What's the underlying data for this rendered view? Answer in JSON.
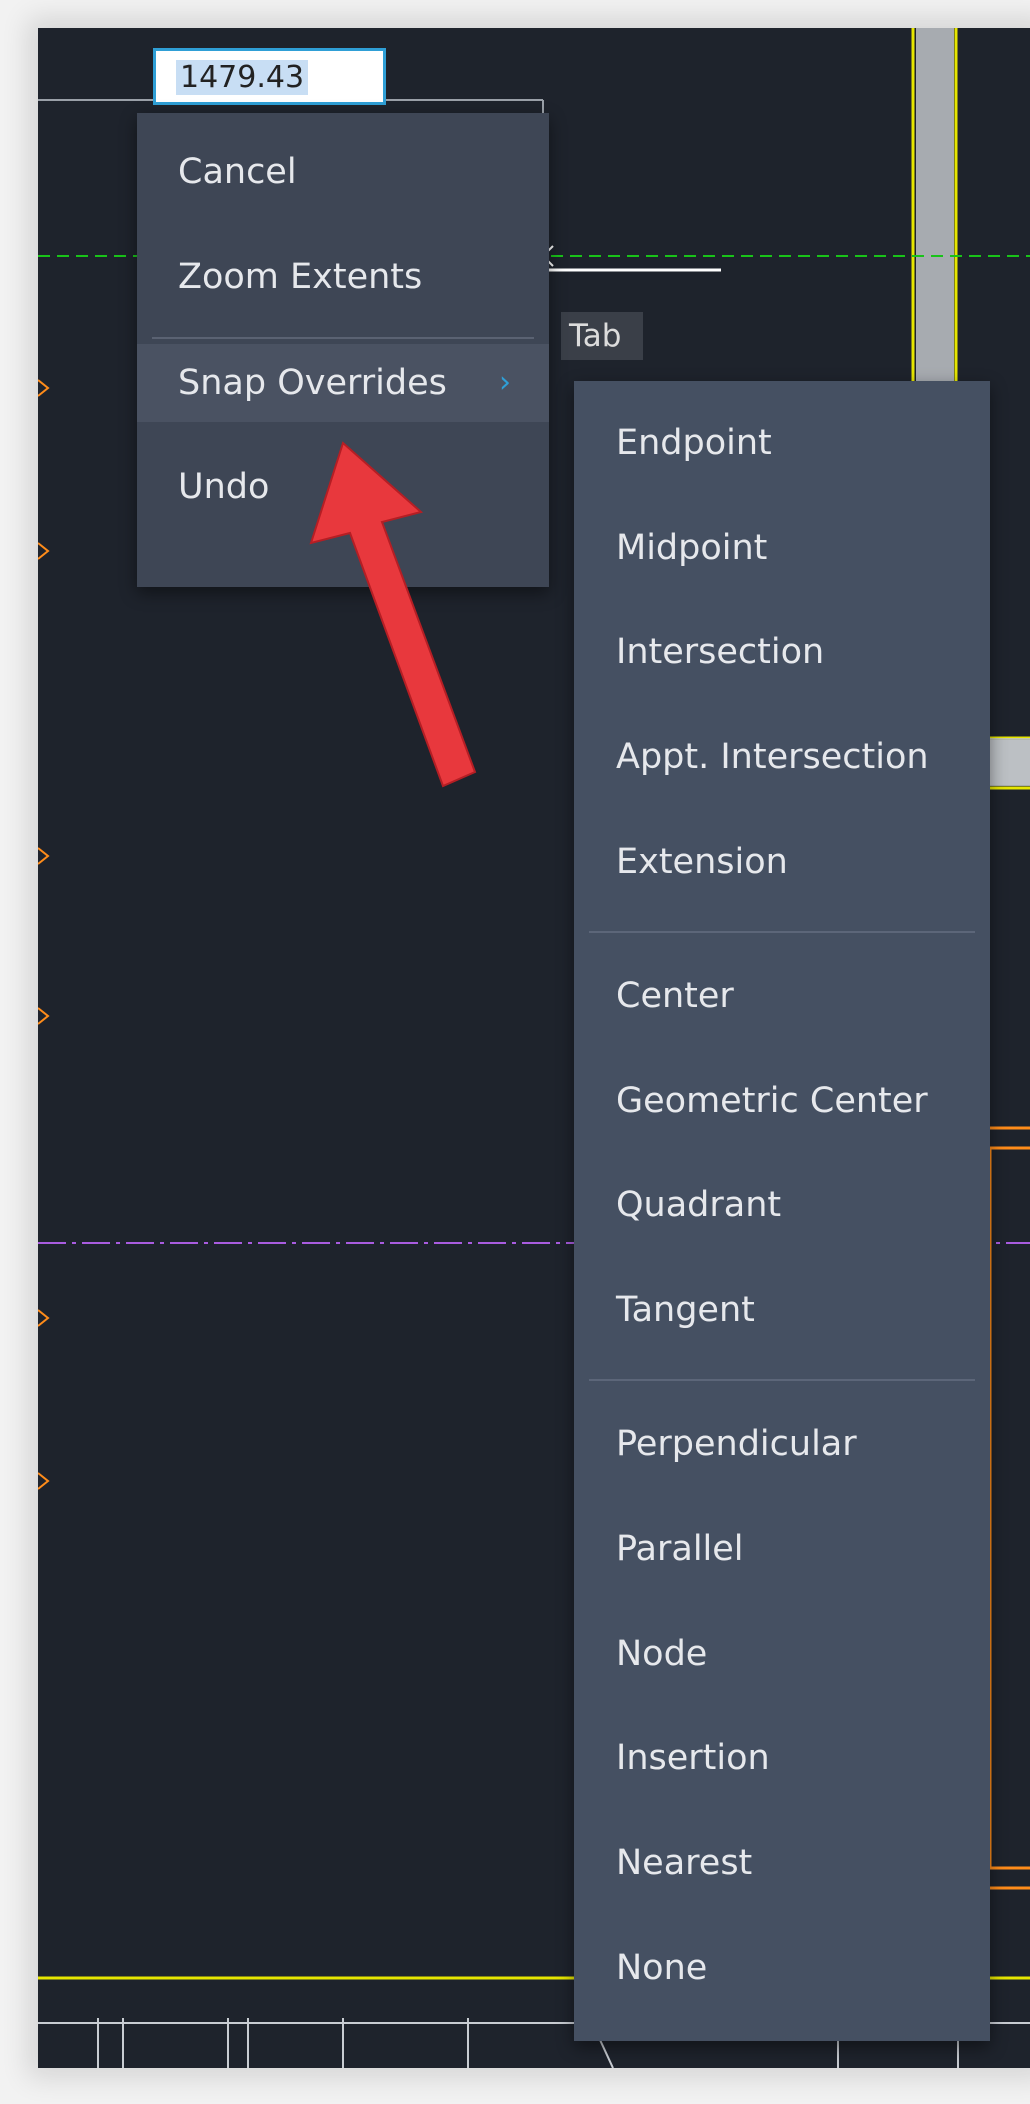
{
  "dynamic_input": {
    "value": "1479.43"
  },
  "cursor": {
    "tooltip": "Tab"
  },
  "context_menu": {
    "items": [
      {
        "label": "Cancel"
      },
      {
        "label": "Zoom Extents"
      },
      {
        "label": "Snap Overrides",
        "has_submenu": true,
        "highlighted": true
      },
      {
        "label": "Undo"
      }
    ]
  },
  "snap_submenu": {
    "groups": [
      [
        "Endpoint",
        "Midpoint",
        "Intersection",
        "Appt. Intersection",
        "Extension"
      ],
      [
        "Center",
        "Geometric Center",
        "Quadrant",
        "Tangent"
      ],
      [
        "Perpendicular",
        "Parallel",
        "Node",
        "Insertion",
        "Nearest",
        "None"
      ]
    ]
  },
  "colors": {
    "canvas_background": "#1e232c",
    "menu_background": "#3e4655",
    "submenu_background": "#455062",
    "accent": "#2f9fd6",
    "callout_arrow": "#e8383d",
    "cad_yellow": "#e6e600",
    "cad_orange": "#ff8c1a",
    "cad_green": "#19c319",
    "cad_purple": "#a95ce0"
  },
  "icons": {
    "submenu_indicator": "chevron-right-icon",
    "cursor": "crosshair-cursor-icon",
    "callout": "red-arrow-icon"
  }
}
